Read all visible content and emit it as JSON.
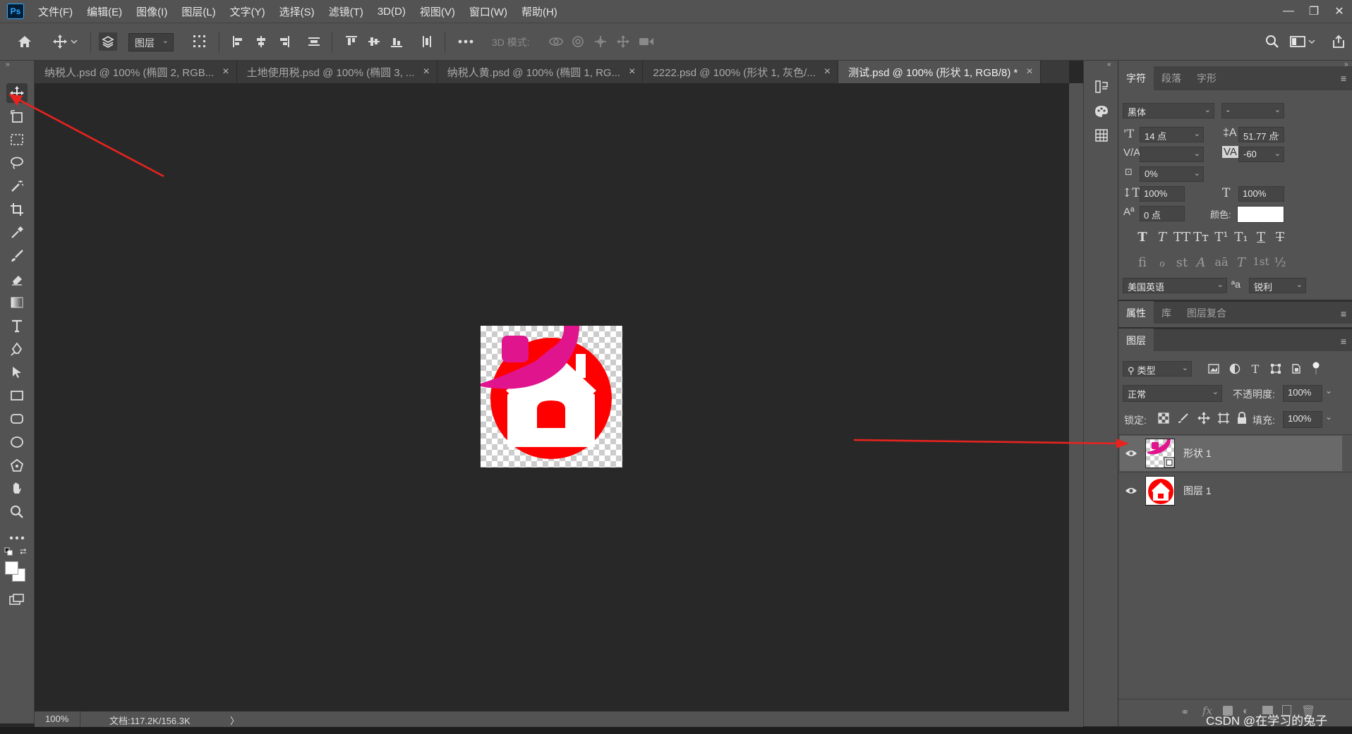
{
  "menubar": {
    "logo": "Ps",
    "items": [
      "文件(F)",
      "编辑(E)",
      "图像(I)",
      "图层(L)",
      "文字(Y)",
      "选择(S)",
      "滤镜(T)",
      "3D(D)",
      "视图(V)",
      "窗口(W)",
      "帮助(H)"
    ],
    "window_controls": [
      "—",
      "❐",
      "✕"
    ]
  },
  "options_bar": {
    "layer_select": "图层",
    "mode_3d_label": "3D 模式:"
  },
  "tabs": [
    {
      "label": "纳税人.psd @ 100% (椭圆 2, RGB...",
      "close": "×",
      "active": false
    },
    {
      "label": "土地使用税.psd @ 100% (椭圆 3, ...",
      "close": "×",
      "active": false
    },
    {
      "label": "纳税人黄.psd @ 100% (椭圆 1, RG...",
      "close": "×",
      "active": false
    },
    {
      "label": "2222.psd @ 100% (形状 1, 灰色/...",
      "close": "×",
      "active": false
    },
    {
      "label": "测试.psd @ 100% (形状 1, RGB/8) *",
      "close": "×",
      "active": true
    }
  ],
  "statusbar": {
    "zoom": "100%",
    "doc_info": "文档:117.2K/156.3K",
    "arrow": "〉"
  },
  "character_panel": {
    "tabs": [
      "字符",
      "段落",
      "字形"
    ],
    "font_family": "黑体",
    "font_style": "-",
    "font_size": "14 点",
    "leading": "51.77 点",
    "kerning": "",
    "tracking": "-60",
    "scale_percent": "0%",
    "vertical_scale": "100%",
    "horizontal_scale": "100%",
    "baseline_shift": "0 点",
    "color_label": "颜色:",
    "color_value": "#ffffff",
    "language": "美国英语",
    "aa_label": "ªa",
    "antialias": "锐利",
    "style_glyphs": [
      "T",
      "T",
      "TT",
      "Tт",
      "T¹",
      "T₁",
      "T",
      "T"
    ],
    "opentype_glyphs": [
      "ﬁ",
      "ℴ",
      "st",
      "A",
      "aā",
      "T",
      "1st",
      "½"
    ]
  },
  "properties_panel": {
    "tabs": [
      "属性",
      "库",
      "图层复合"
    ]
  },
  "layers_panel": {
    "title": "图层",
    "filter_kind": "类型",
    "blend_mode": "正常",
    "opacity_label": "不透明度:",
    "opacity": "100%",
    "lock_label": "锁定:",
    "fill_label": "填充:",
    "fill": "100%",
    "layers": [
      {
        "name": "形状 1",
        "selected": true,
        "visible": true
      },
      {
        "name": "图层 1",
        "selected": false,
        "visible": true
      }
    ]
  },
  "watermark": "CSDN @在学习的兔子",
  "colors": {
    "accent_red": "#ff0000",
    "accent_magenta": "#e0148c",
    "ps_blue": "#31a8ff",
    "annotation_arrow": "#e8231f"
  }
}
